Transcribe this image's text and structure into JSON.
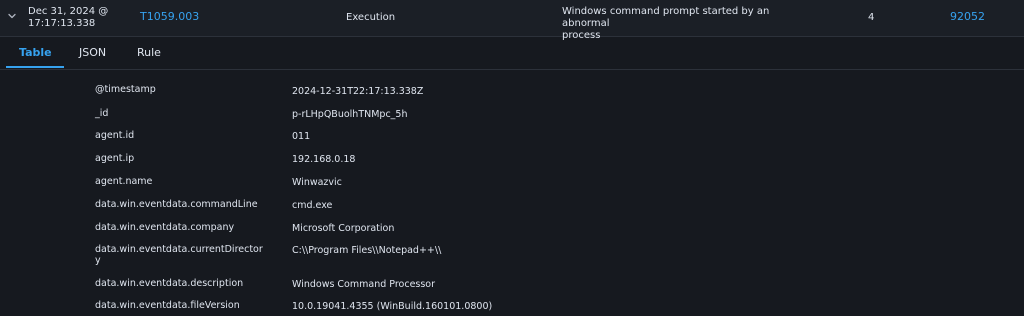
{
  "alert": {
    "timestamp_line1": "Dec 31, 2024 @",
    "timestamp_line2": "17:17:13.338",
    "technique": "T1059.003",
    "tactic": "Execution",
    "description_line1": "Windows command prompt started by an abnormal",
    "description_line2": "process",
    "level": "4",
    "rule_id": "92052"
  },
  "tabs": [
    {
      "label": "Table",
      "active": true
    },
    {
      "label": "JSON",
      "active": false
    },
    {
      "label": "Rule",
      "active": false
    }
  ],
  "fields": [
    {
      "key": "@timestamp",
      "value": "2024-12-31T22:17:13.338Z"
    },
    {
      "key": "_id",
      "value": "p-rLHpQBuolhTNMpc_5h"
    },
    {
      "key": "agent.id",
      "value": "011"
    },
    {
      "key": "agent.ip",
      "value": "192.168.0.18"
    },
    {
      "key": "agent.name",
      "value": "Winwazvic"
    },
    {
      "key": "data.win.eventdata.commandLine",
      "value": "cmd.exe"
    },
    {
      "key": "data.win.eventdata.company",
      "value": "Microsoft Corporation"
    },
    {
      "key": "data.win.eventdata.currentDirector",
      "key2": "y",
      "value": "C:\\\\Program Files\\\\Notepad++\\\\"
    },
    {
      "key": "data.win.eventdata.description",
      "value": "Windows Command Processor"
    },
    {
      "key": "data.win.eventdata.fileVersion",
      "value": "10.0.19041.4355 (WinBuild.160101.0800)"
    }
  ],
  "colors": {
    "background": "#16191f",
    "row_background": "#1b1f26",
    "link": "#36a2ef",
    "text": "#dfe5ef"
  },
  "icons": {
    "expand": "chevron-down-icon"
  }
}
